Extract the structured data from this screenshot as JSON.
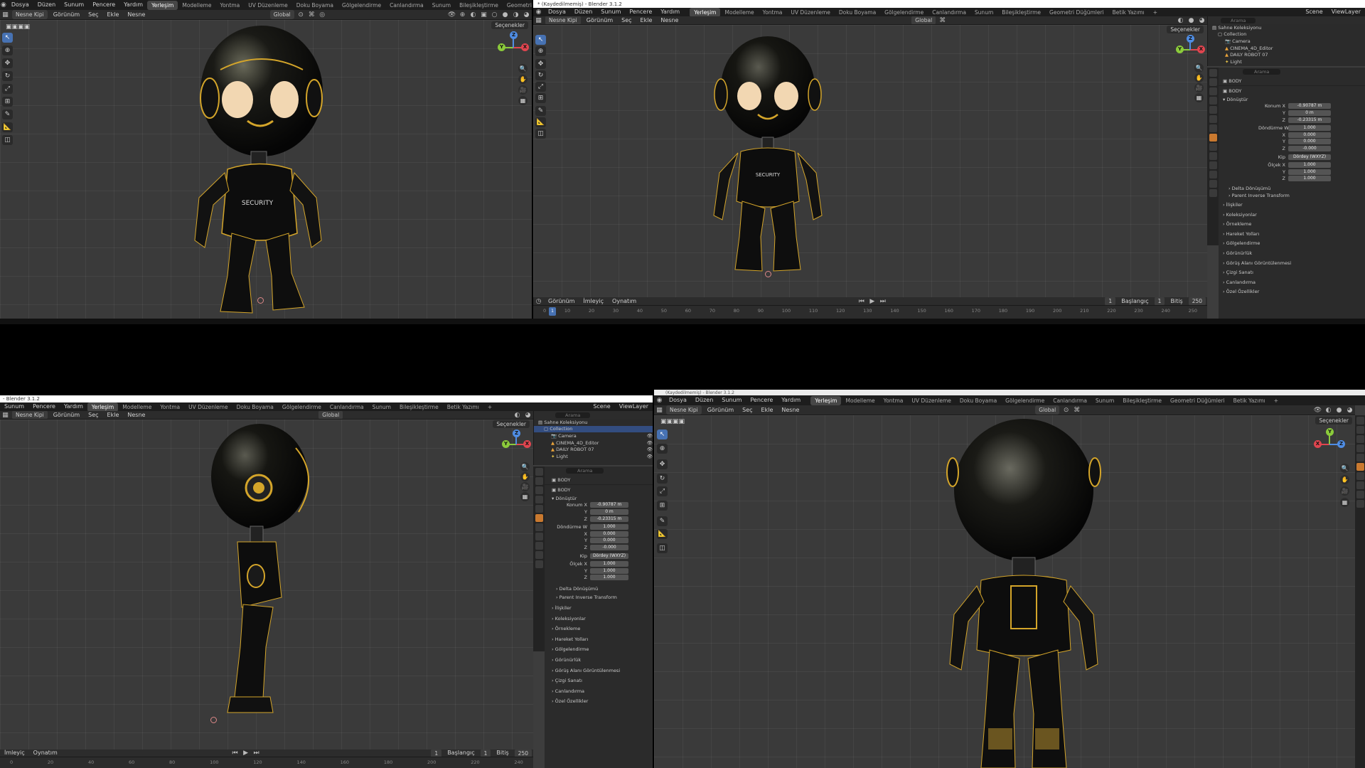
{
  "menus": {
    "file": "Dosya",
    "edit": "Düzen",
    "render": "Sunum",
    "window": "Pencere",
    "help": "Yardım"
  },
  "workspaces": [
    "Yerleşim",
    "Modelleme",
    "Yontma",
    "UV Düzenleme",
    "Doku Boyama",
    "Gölgelendirme",
    "Canlandırma",
    "Sunum",
    "Bileşikleştirme",
    "Geometri Düğümleri",
    "Betik Yazımı"
  ],
  "workspaces_short": [
    "Yerleşim",
    "Modelleme",
    "Yontma",
    "UV Düzenleme",
    "Doku Boyama",
    "Gölgelendirme",
    "Canlandırma",
    "Sunum",
    "Bileşikleştirme",
    "Geometri Düğümleri",
    "Betik Yazımı"
  ],
  "view_header": {
    "mode": "Nesne Kipi",
    "view": "Görünüm",
    "select": "Seç",
    "add": "Ekle",
    "object": "Nesne",
    "orientation": "Global",
    "options": "Seçenekler"
  },
  "window_titles": {
    "top_right": "* (Kaydedilmemiş) - Blender 3.1.2",
    "bottom_left": "- Blender 3.1.2",
    "bottom_right_strip": "(Kaydedilmemiş) - Blender 3.1.2"
  },
  "gizmo": {
    "x": "X",
    "y": "Y",
    "z": "Z"
  },
  "robot_text": "SECURITY",
  "timeline": {
    "playback": "Görünüm",
    "keying": "İmleyiç",
    "view": "Oynatım",
    "frame_current": "1",
    "start_label": "Başlangıç",
    "start": "1",
    "end_label": "Bitiş",
    "end": "250",
    "ticks": [
      "0",
      "10",
      "20",
      "30",
      "40",
      "50",
      "60",
      "70",
      "80",
      "90",
      "100",
      "110",
      "120",
      "130",
      "140",
      "150",
      "160",
      "170",
      "180",
      "190",
      "200",
      "210",
      "220",
      "230",
      "240",
      "250"
    ],
    "ticks_bl": [
      "0",
      "20",
      "40",
      "60",
      "80",
      "100",
      "120",
      "140",
      "160",
      "180",
      "200",
      "220",
      "240"
    ]
  },
  "outliner": {
    "search_placeholder": "Arama",
    "scene": "Scene",
    "view_layer": "ViewLayer",
    "root": "Sahne Koleksiyonu",
    "collection": "Collection",
    "items": [
      "Camera",
      "CINEMA_4D_Editor",
      "DAILY ROBOT 07",
      "Light"
    ]
  },
  "properties": {
    "search_placeholder": "Arama",
    "object_name": "BODY",
    "mesh_name": "BODY",
    "transform": "Dönüştür",
    "location_label": "Konum X",
    "loc": [
      "-0.90787 m",
      "0 m",
      "-0.23315 m"
    ],
    "rotation_label": "Döndürme W",
    "rot": [
      "1.000",
      "0.000",
      "0.000",
      "-0.000"
    ],
    "mode_label": "Kip",
    "mode": "Dördey (WXYZ)",
    "scale_label": "Ölçek X",
    "scale": [
      "1.000",
      "1.000",
      "1.000"
    ],
    "axis": [
      "Y",
      "Z",
      "X"
    ],
    "sections": [
      "Delta Dönüşümü",
      "Parent Inverse Transform"
    ],
    "panels": [
      "İlişkiler",
      "Koleksiyonlar",
      "Örnekleme",
      "Hareket Yolları",
      "Gölgelendirme",
      "Görünürlük",
      "Görüş Alanı Görüntülenmesi",
      "Çizgi Sanatı",
      "Canlandırma",
      "Özel Özellikler"
    ]
  },
  "colors": {
    "accent": "#4772b3",
    "gold": "#d4a52a",
    "x_axis": "#e0454f",
    "y_axis": "#8bcb3b",
    "z_axis": "#4f8de4"
  }
}
